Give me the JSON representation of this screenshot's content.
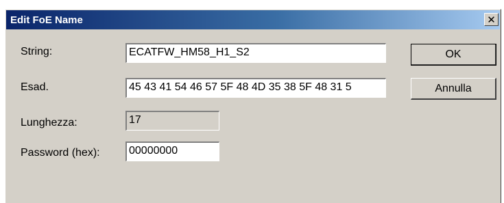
{
  "dialog": {
    "title": "Edit FoE Name",
    "close_glyph": "✕",
    "close_icon": "close-icon"
  },
  "fields": {
    "string": {
      "label": "String:",
      "value": "ECATFW_HM58_H1_S2"
    },
    "hex": {
      "label": "Esad.",
      "value": "45 43 41 54 46 57 5F 48 4D 35 38 5F 48 31 5"
    },
    "length": {
      "label": "Lunghezza:",
      "value": "17"
    },
    "password": {
      "label": "Password (hex):",
      "value": "00000000"
    }
  },
  "buttons": {
    "ok": "OK",
    "cancel": "Annulla"
  }
}
